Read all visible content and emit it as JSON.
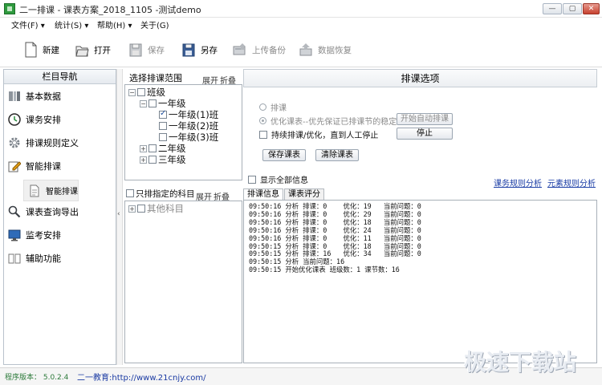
{
  "window": {
    "title": "二一排课 - 课表方案_2018_1105 -测试demo"
  },
  "menu": [
    {
      "label": "文件(F)",
      "has_arrow": true
    },
    {
      "label": "统计(S)",
      "has_arrow": true
    },
    {
      "label": "帮助(H)",
      "has_arrow": true
    },
    {
      "label": "关于(G)",
      "has_arrow": false
    }
  ],
  "toolbar": {
    "new_label": "新建",
    "open_label": "打开",
    "save_label": "保存",
    "saveas_label": "另存",
    "upload_label": "上传备份",
    "restore_label": "数据恢复"
  },
  "nav": {
    "title": "栏目导航",
    "items": [
      {
        "label": "基本数据",
        "icon": "database-icon"
      },
      {
        "label": "课务安排",
        "icon": "clock-icon"
      },
      {
        "label": "排课规则定义",
        "icon": "gear-icon"
      },
      {
        "label": "智能排课",
        "icon": "pencil-icon"
      },
      {
        "label": "课表查询导出",
        "icon": "magnifier-icon"
      },
      {
        "label": "监考安排",
        "icon": "monitor-icon"
      },
      {
        "label": "辅助功能",
        "icon": "book-icon"
      }
    ],
    "sub_item": {
      "label": "智能排课",
      "icon": "document-icon"
    }
  },
  "scope": {
    "title": "选择排课范围",
    "expand": "展开",
    "collapse": "折叠",
    "tree": [
      {
        "label": "班级",
        "expander": "−",
        "checked": false,
        "level": 0
      },
      {
        "label": "一年级",
        "expander": "−",
        "checked": false,
        "level": 1
      },
      {
        "label": "一年级(1)班",
        "expander": "",
        "checked": true,
        "level": 2
      },
      {
        "label": "一年级(2)班",
        "expander": "",
        "checked": false,
        "level": 2
      },
      {
        "label": "一年级(3)班",
        "expander": "",
        "checked": false,
        "level": 2
      },
      {
        "label": "二年级",
        "expander": "+",
        "checked": false,
        "level": 1
      },
      {
        "label": "三年级",
        "expander": "+",
        "checked": false,
        "level": 1
      }
    ],
    "subjects_title": "只排指定的科目",
    "subjects_expand": "展开",
    "subjects_collapse": "折叠",
    "subjects": [
      {
        "label": "其他科目",
        "expander": "+"
      }
    ]
  },
  "options": {
    "title": "排课选项",
    "radio1": "排课",
    "radio2": "优化课表--优先保证已排课节的稳定",
    "checkbox_continue": "持续排课/优化，直到人工停止",
    "start_button": "开始自动排课",
    "stop_button": "停止",
    "save_button": "保存课表",
    "clear_button": "清除课表",
    "show_all": "显示全部信息",
    "link_rules": "课务规则分析",
    "link_elements": "元素规则分析"
  },
  "tabs": [
    {
      "label": "排课信息",
      "active": true
    },
    {
      "label": "课表评分",
      "active": false
    }
  ],
  "log": [
    "09:50:16 分析 排课：0    优化：19   当前问题：0",
    "09:50:16 分析 排课：0    优化：29   当前问题：0",
    "09:50:16 分析 排课：0    优化：18   当前问题：0",
    "09:50:16 分析 排课：0    优化：24   当前问题：0",
    "09:50:16 分析 排课：0    优化：11   当前问题：0",
    "09:50:15 分析 排课：0    优化：18   当前问题：0",
    "09:50:15 分析 排课：16   优化：34   当前问题：0",
    "09:50:15 分析 当前问题：16",
    "09:50:15 开始优化课表 班级数：1 课节数：16"
  ],
  "status": {
    "version": "程序版本： 5.0.2.4",
    "company": "二一教育:http://www.21cnjy.com/"
  },
  "watermark": "极速下载站"
}
